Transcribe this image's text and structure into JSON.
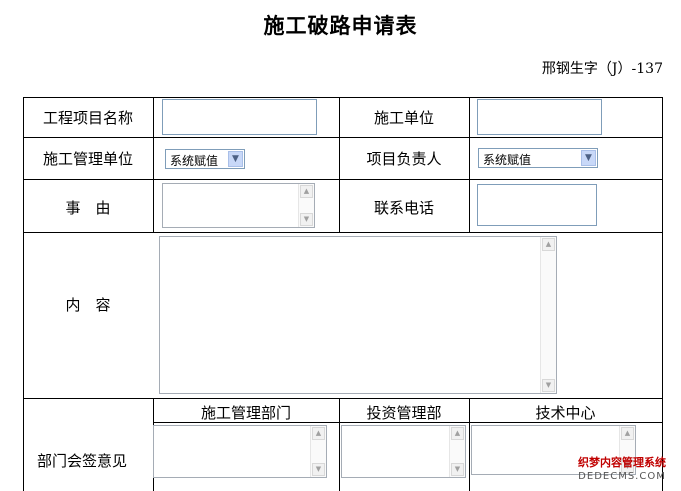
{
  "page": {
    "title": "施工破路申请表",
    "doc_number": "邢钢生字（J）-137"
  },
  "form": {
    "project_name_label": "工程项目名称",
    "project_name_value": "",
    "construction_unit_label": "施工单位",
    "construction_unit_value": "",
    "construction_mgmt_unit_label": "施工管理单位",
    "construction_mgmt_unit_select": "系统赋值",
    "project_lead_label": "项目负责人",
    "project_lead_select": "系统赋值",
    "reason_label": "事　由",
    "reason_value": "",
    "phone_label": "联系电话",
    "phone_value": "",
    "content_label": "内　容",
    "content_value": "",
    "dept_opinion_label": "部门会签意见",
    "depts": [
      {
        "label": "施工管理部门",
        "value": ""
      },
      {
        "label": "投资管理部",
        "value": ""
      },
      {
        "label": "技术中心",
        "value": ""
      }
    ]
  },
  "watermark": {
    "line1": "织梦内容管理系统",
    "line2": "DEDECMS.COM"
  }
}
